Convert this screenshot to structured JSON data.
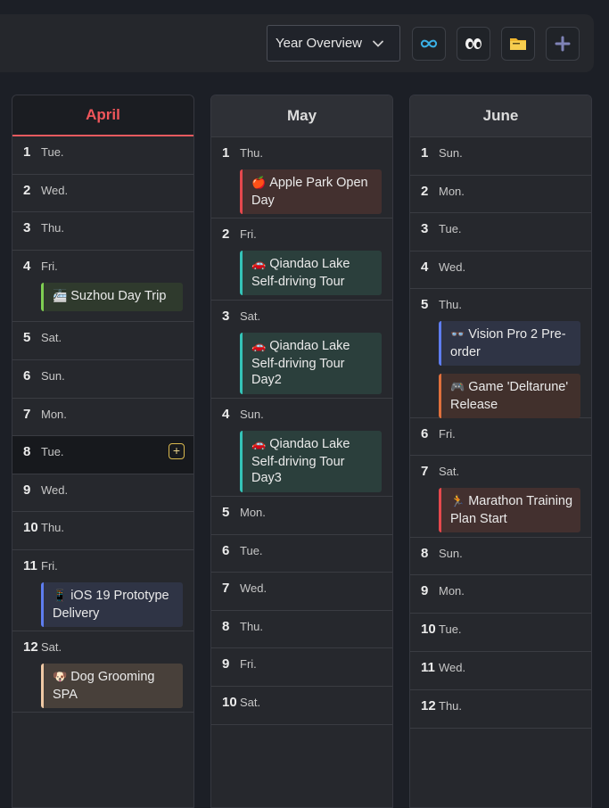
{
  "toolbar": {
    "view_select": "Year Overview"
  },
  "months": [
    {
      "name": "April",
      "active": true,
      "days": [
        {
          "num": "1",
          "wd": "Tue."
        },
        {
          "num": "2",
          "wd": "Wed."
        },
        {
          "num": "3",
          "wd": "Thu."
        },
        {
          "num": "4",
          "wd": "Fri.",
          "events": [
            {
              "icon": "🚈",
              "title": "Suzhou Day Trip",
              "color": "green"
            }
          ]
        },
        {
          "num": "5",
          "wd": "Sat."
        },
        {
          "num": "6",
          "wd": "Sun."
        },
        {
          "num": "7",
          "wd": "Mon."
        },
        {
          "num": "8",
          "wd": "Tue.",
          "highlight": true
        },
        {
          "num": "9",
          "wd": "Wed."
        },
        {
          "num": "10",
          "wd": "Thu."
        },
        {
          "num": "11",
          "wd": "Fri.",
          "events": [
            {
              "icon": "📱",
              "title": "iOS 19 Prototype Delivery",
              "color": "blue"
            }
          ]
        },
        {
          "num": "12",
          "wd": "Sat.",
          "events": [
            {
              "icon": "🐶",
              "title": "Dog Grooming SPA",
              "color": "beige"
            }
          ]
        }
      ]
    },
    {
      "name": "May",
      "active": false,
      "days": [
        {
          "num": "1",
          "wd": "Thu.",
          "events": [
            {
              "icon": "🍎",
              "title": "Apple Park Open Day",
              "color": "red"
            }
          ]
        },
        {
          "num": "2",
          "wd": "Fri.",
          "events": [
            {
              "icon": "🚗",
              "title": "Qiandao Lake Self-driving Tour",
              "color": "teal"
            }
          ]
        },
        {
          "num": "3",
          "wd": "Sat.",
          "events": [
            {
              "icon": "🚗",
              "title": "Qiandao Lake Self-driving Tour Day2",
              "color": "teal"
            }
          ]
        },
        {
          "num": "4",
          "wd": "Sun.",
          "events": [
            {
              "icon": "🚗",
              "title": "Qiandao Lake Self-driving Tour Day3",
              "color": "teal"
            }
          ]
        },
        {
          "num": "5",
          "wd": "Mon."
        },
        {
          "num": "6",
          "wd": "Tue."
        },
        {
          "num": "7",
          "wd": "Wed."
        },
        {
          "num": "8",
          "wd": "Thu."
        },
        {
          "num": "9",
          "wd": "Fri."
        },
        {
          "num": "10",
          "wd": "Sat."
        }
      ]
    },
    {
      "name": "June",
      "active": false,
      "days": [
        {
          "num": "1",
          "wd": "Sun."
        },
        {
          "num": "2",
          "wd": "Mon."
        },
        {
          "num": "3",
          "wd": "Tue."
        },
        {
          "num": "4",
          "wd": "Wed."
        },
        {
          "num": "5",
          "wd": "Thu.",
          "events": [
            {
              "icon": "👓",
              "title": "Vision Pro 2 Pre-order",
              "color": "blue"
            },
            {
              "icon": "🎮",
              "title": "Game 'Deltarune' Release",
              "color": "orange"
            }
          ]
        },
        {
          "num": "6",
          "wd": "Fri."
        },
        {
          "num": "7",
          "wd": "Sat.",
          "events": [
            {
              "icon": "🏃",
              "title": "Marathon Training Plan Start",
              "color": "red"
            }
          ]
        },
        {
          "num": "8",
          "wd": "Sun."
        },
        {
          "num": "9",
          "wd": "Mon."
        },
        {
          "num": "10",
          "wd": "Tue."
        },
        {
          "num": "11",
          "wd": "Wed."
        },
        {
          "num": "12",
          "wd": "Thu."
        }
      ]
    }
  ]
}
